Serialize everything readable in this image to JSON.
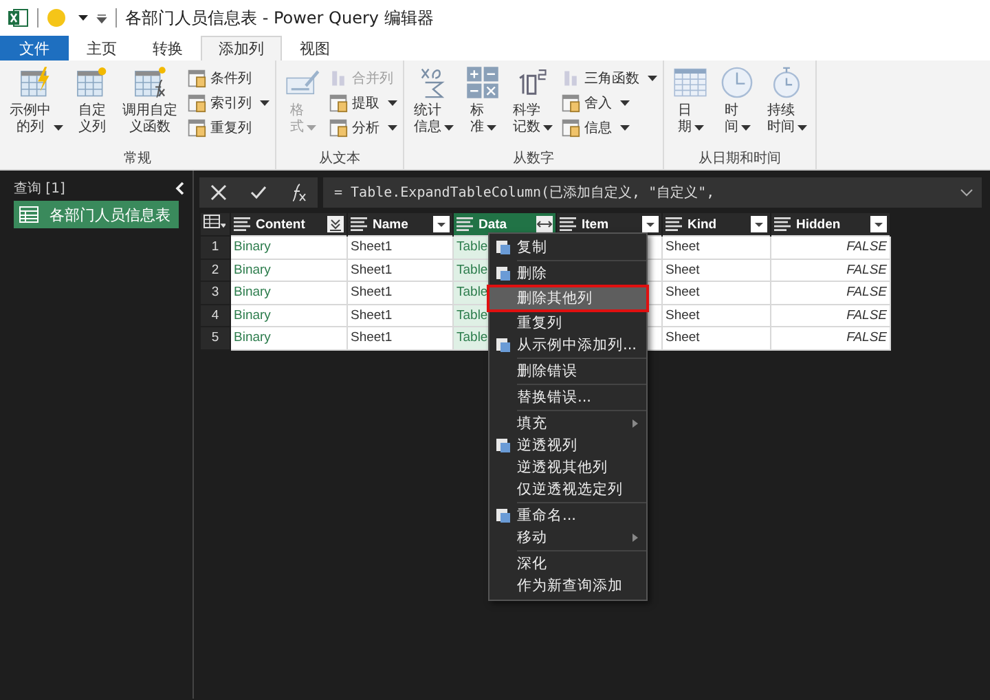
{
  "window": {
    "title": "各部门人员信息表 - Power Query 编辑器"
  },
  "tabs": [
    {
      "label": "文件",
      "kind": "file",
      "selected": false
    },
    {
      "label": "主页",
      "kind": "tab",
      "selected": false
    },
    {
      "label": "转换",
      "kind": "tab",
      "selected": false
    },
    {
      "label": "添加列",
      "kind": "tab",
      "selected": true
    },
    {
      "label": "视图",
      "kind": "tab",
      "selected": false
    }
  ],
  "ribbon": {
    "groups": [
      {
        "label": "常规",
        "large": [
          {
            "label": "示例中的列",
            "dropdown": true,
            "disabled": false
          },
          {
            "label": "自定义列",
            "dropdown": false,
            "disabled": false
          },
          {
            "label": "调用自定义函数",
            "dropdown": false,
            "disabled": false
          }
        ],
        "small": [
          {
            "label": "条件列",
            "dropdown": false,
            "disabled": false
          },
          {
            "label": "索引列",
            "dropdown": true,
            "disabled": false
          },
          {
            "label": "重复列",
            "dropdown": false,
            "disabled": false
          }
        ]
      },
      {
        "label": "从文本",
        "large": [
          {
            "label": "格式",
            "dropdown": true,
            "disabled": true
          }
        ],
        "small": [
          {
            "label": "合并列",
            "dropdown": false,
            "disabled": true
          },
          {
            "label": "提取",
            "dropdown": true,
            "disabled": false
          },
          {
            "label": "分析",
            "dropdown": true,
            "disabled": false
          }
        ]
      },
      {
        "label": "从数字",
        "large": [
          {
            "label": "统计信息",
            "dropdown": true,
            "disabled": false
          },
          {
            "label": "标准",
            "dropdown": true,
            "disabled": false
          },
          {
            "label": "科学记数",
            "dropdown": true,
            "disabled": false
          }
        ],
        "small": [
          {
            "label": "三角函数",
            "dropdown": true,
            "disabled": false
          },
          {
            "label": "舍入",
            "dropdown": true,
            "disabled": false
          },
          {
            "label": "信息",
            "dropdown": true,
            "disabled": false
          }
        ]
      },
      {
        "label": "从日期和时间",
        "large": [
          {
            "label": "日期",
            "dropdown": true,
            "disabled": false
          },
          {
            "label": "时间",
            "dropdown": true,
            "disabled": false
          },
          {
            "label": "持续时间",
            "dropdown": true,
            "disabled": false
          }
        ]
      }
    ]
  },
  "queries": {
    "title": "查询 [1]",
    "items": [
      {
        "label": "各部门人员信息表",
        "selected": true
      }
    ]
  },
  "formula_bar": {
    "formula": "= Table.ExpandTableColumn(已添加自定义, \"自定义\","
  },
  "table": {
    "columns": [
      {
        "name": "Content",
        "kind": "binary",
        "selected": false
      },
      {
        "name": "Name",
        "kind": "any",
        "selected": false
      },
      {
        "name": "Data",
        "kind": "table",
        "selected": true
      },
      {
        "name": "Item",
        "kind": "any",
        "selected": false
      },
      {
        "name": "Kind",
        "kind": "any",
        "selected": false
      },
      {
        "name": "Hidden",
        "kind": "any",
        "selected": false
      }
    ],
    "rows": [
      {
        "number": "1",
        "cells": [
          "Binary",
          "Sheet1",
          "Table",
          null,
          "Sheet",
          "FALSE"
        ]
      },
      {
        "number": "2",
        "cells": [
          "Binary",
          "Sheet1",
          "Table",
          null,
          "Sheet",
          "FALSE"
        ]
      },
      {
        "number": "3",
        "cells": [
          "Binary",
          "Sheet1",
          "Table",
          null,
          "Sheet",
          "FALSE"
        ]
      },
      {
        "number": "4",
        "cells": [
          "Binary",
          "Sheet1",
          "Table",
          null,
          "Sheet",
          "FALSE"
        ]
      },
      {
        "number": "5",
        "cells": [
          "Binary",
          "Sheet1",
          "Table",
          null,
          "Sheet",
          "FALSE"
        ]
      }
    ]
  },
  "context_menu": {
    "items": [
      {
        "kind": "item",
        "label": "复制",
        "icon": true,
        "submenu": false,
        "selected": false
      },
      {
        "kind": "separator"
      },
      {
        "kind": "item",
        "label": "删除",
        "icon": true,
        "submenu": false,
        "selected": false
      },
      {
        "kind": "item",
        "label": "删除其他列",
        "icon": false,
        "submenu": false,
        "selected": true
      },
      {
        "kind": "item",
        "label": "重复列",
        "icon": false,
        "submenu": false,
        "selected": false
      },
      {
        "kind": "item",
        "label": "从示例中添加列...",
        "icon": true,
        "submenu": false,
        "selected": false
      },
      {
        "kind": "separator"
      },
      {
        "kind": "item",
        "label": "删除错误",
        "icon": false,
        "submenu": false,
        "selected": false
      },
      {
        "kind": "separator"
      },
      {
        "kind": "item",
        "label": "替换错误...",
        "icon": false,
        "submenu": false,
        "selected": false
      },
      {
        "kind": "separator"
      },
      {
        "kind": "item",
        "label": "填充",
        "icon": false,
        "submenu": true,
        "selected": false
      },
      {
        "kind": "item",
        "label": "逆透视列",
        "icon": true,
        "submenu": false,
        "selected": false
      },
      {
        "kind": "item",
        "label": "逆透视其他列",
        "icon": false,
        "submenu": false,
        "selected": false
      },
      {
        "kind": "item",
        "label": "仅逆透视选定列",
        "icon": false,
        "submenu": false,
        "selected": false
      },
      {
        "kind": "separator"
      },
      {
        "kind": "item",
        "label": "重命名...",
        "icon": true,
        "submenu": false,
        "selected": false
      },
      {
        "kind": "item",
        "label": "移动",
        "icon": false,
        "submenu": true,
        "selected": false
      },
      {
        "kind": "separator"
      },
      {
        "kind": "item",
        "label": "深化",
        "icon": false,
        "submenu": false,
        "selected": false
      },
      {
        "kind": "item",
        "label": "作为新查询添加",
        "icon": false,
        "submenu": false,
        "selected": false
      }
    ]
  }
}
